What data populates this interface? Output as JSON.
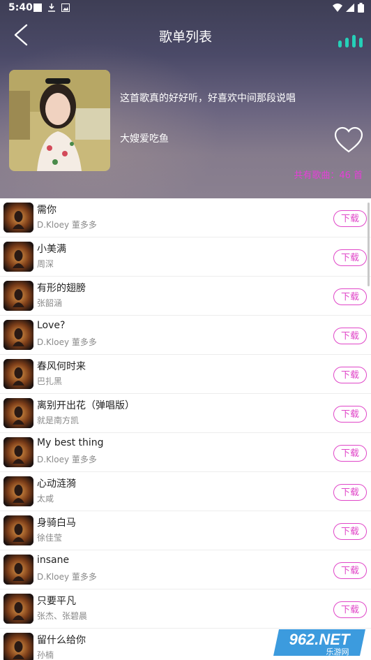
{
  "status": {
    "time": "5:40"
  },
  "header": {
    "title": "歌单列表",
    "description": "这首歌真的好好听，好喜欢中间那段说唱",
    "author": "大嫂爱吃鱼",
    "song_count": "共有歌曲：46 首"
  },
  "download_label": "下载",
  "songs": [
    {
      "title": "需你",
      "artist": "D.Kloey 董多多"
    },
    {
      "title": "小美满",
      "artist": "周深"
    },
    {
      "title": "有形的翅膀",
      "artist": "张韶涵"
    },
    {
      "title": "Love?",
      "artist": "D.Kloey 董多多"
    },
    {
      "title": "春风何时来",
      "artist": "巴扎黑"
    },
    {
      "title": "离别开出花（弹唱版）",
      "artist": "就是南方凯"
    },
    {
      "title": "My best thing",
      "artist": "D.Kloey 董多多"
    },
    {
      "title": "心动涟漪",
      "artist": "太咸"
    },
    {
      "title": "身骑白马",
      "artist": "徐佳莹"
    },
    {
      "title": "insane",
      "artist": "D.Kloey 董多多"
    },
    {
      "title": "只要平凡",
      "artist": "张杰、张碧晨"
    },
    {
      "title": "留什么给你",
      "artist": "孙楠"
    }
  ],
  "watermark": {
    "brand": "962.NET",
    "sub": "乐游网"
  },
  "colors": {
    "accent": "#e046c8",
    "count": "#e63ed8",
    "equalizer": "#25d0b8"
  },
  "icons": [
    "back-arrow-icon",
    "heart-icon",
    "equalizer-icon",
    "download-icon"
  ]
}
